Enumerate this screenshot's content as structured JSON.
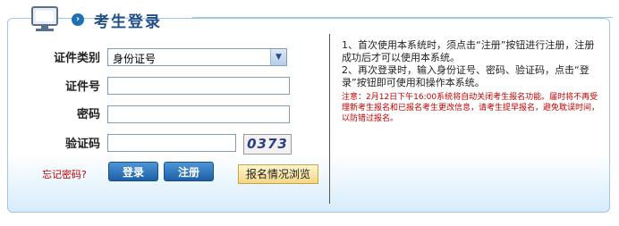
{
  "header": {
    "title": "考生登录",
    "logo_icon": "computer-icon",
    "arrow_icon": "arrow-right-icon"
  },
  "form": {
    "id_type_label": "证件类别",
    "id_type_value": "身份证号",
    "id_number_label": "证件号",
    "id_number_value": "",
    "password_label": "密码",
    "password_value": "",
    "captcha_label": "验证码",
    "captcha_value": "",
    "captcha_image_text": "0373",
    "forgot_link": "忘记密码?",
    "login_button": "登录",
    "register_button": "注册",
    "browse_button": "报名情况浏览"
  },
  "notes": {
    "item1": "1、首次使用本系统时，须点击“注册”按钮进行注册，注册成功后才可以使用本系统。",
    "item2": "2、再次登录时，输入身份证号、密码、验证码，点击“登录”按钮即可使用和操作本系统。",
    "notice": "注意：2月12日下午16:00系统将自动关闭考生报名功能。届时将不再受理新考生报名和已报名考生更改信息，请考生提早报名，避免耽误时间，以防错过报名。"
  },
  "colors": {
    "accent": "#1f6fb5",
    "title": "#1f4f86",
    "warning": "#c00000",
    "border": "#9ec7e8"
  }
}
